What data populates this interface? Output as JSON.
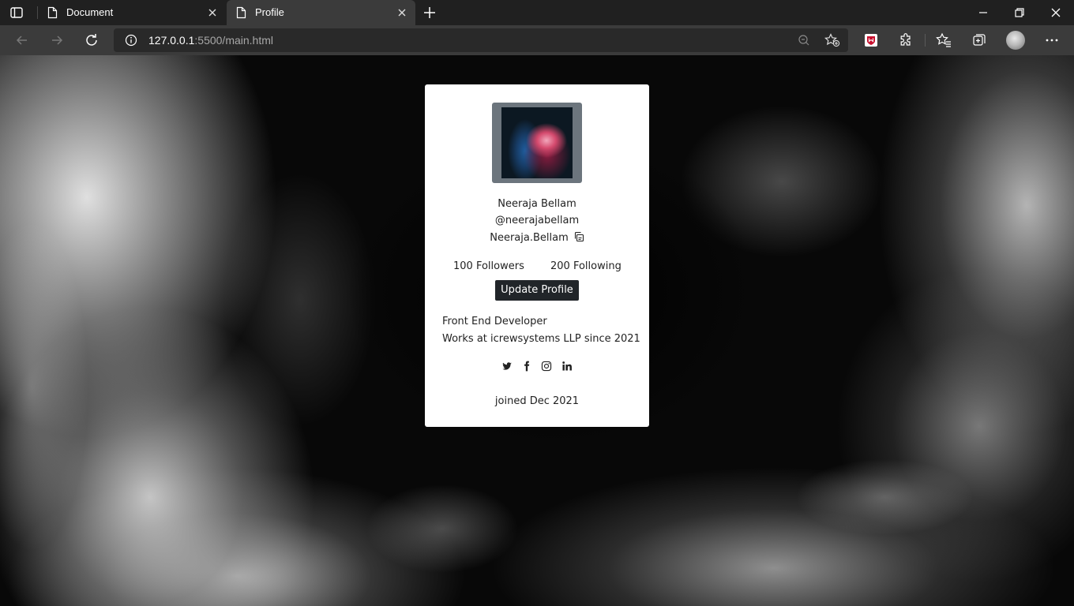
{
  "browser": {
    "tabs": [
      {
        "title": "Document",
        "active": false
      },
      {
        "title": "Profile",
        "active": true
      }
    ],
    "address": {
      "host": "127.0.0.1",
      "rest": ":5500/main.html"
    }
  },
  "profile": {
    "name": "Neeraja Bellam",
    "username": "@neerajabellam",
    "handle": "Neeraja.Bellam",
    "followers": "100 Followers",
    "following": "200 Following",
    "update_button": "Update Profile",
    "bio_line1": "Front End Developer",
    "bio_line2": "Works at icrewsystems LLP since 2021",
    "social_icons": [
      "twitter-icon",
      "facebook-icon",
      "instagram-icon",
      "linkedin-icon"
    ],
    "joined": "joined Dec 2021"
  },
  "colors": {
    "tabbar": "#202020",
    "toolbar": "#3b3b3b",
    "card": "#ffffff",
    "button": "#212529",
    "photo_frame": "#6c757d"
  }
}
